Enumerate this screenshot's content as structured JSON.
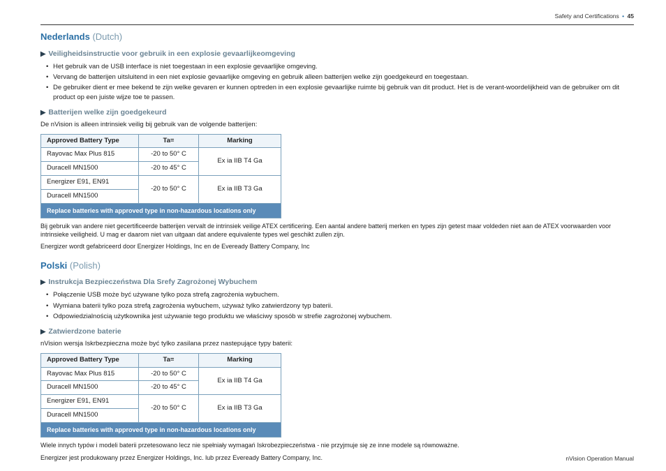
{
  "header": {
    "section": "Safety and Certifications",
    "page": "45"
  },
  "footer": {
    "manual": "nVision Operation Manual"
  },
  "triangle": "▶",
  "dutch": {
    "lang": "Nederlands",
    "paren": "(Dutch)",
    "subhead1": "Veiligheidsinstructie voor gebruik in een explosie gevaarlijkeomgeving",
    "bullets": [
      "Het gebruik van de USB interface is niet toegestaan in een explosie gevaarlijke omgeving.",
      "Vervang de batterijen uitsluitend in een niet explosie gevaarlijke omgeving en gebruik alleen batterijen welke zijn goedgekeurd en toegestaan.",
      "De gebruiker dient er mee bekend te zijn welke gevaren er kunnen optreden in een explosie gevaarlijke ruimte bij gebruik van dit product. Het is de verant-woordelijkheid van de gebruiker om dit product op een juiste wijze toe te passen."
    ],
    "subhead2": "Batterijen welke zijn goedgekeurd",
    "intro2": "De nVision is alleen intrinsiek veilig bij gebruik van de volgende batterijen:",
    "after1": "Bij gebruik van andere niet gecertificeerde batterijen vervalt de intrinsiek veilige ATEX certificering. Een aantal andere batterij merken en types zijn getest maar voldeden niet aan de ATEX voorwaarden voor intrinsieke veiligheid. U mag er daarom niet van uitgaan dat andere equivalente types wel geschikt zullen zijn.",
    "after2": "Energizer wordt gefabriceerd door Energizer Holdings, Inc en de Eveready Battery Company, Inc"
  },
  "polish": {
    "lang": "Polski",
    "paren": "(Polish)",
    "subhead1": "Instrukcja Bezpieczeństwa Dla Srefy Zagrożonej Wybuchem",
    "bullets": [
      "Połączenie USB może być używane tylko poza strefą zagrożenia wybuchem.",
      "Wymiana baterii tylko poza strefą zagrożenia wybuchem, używaż tylko zatwierdzony typ baterii.",
      "Odpowiedzialnością użytkownika jest używanie tego produktu we właściwy sposób w strefie zagrożonej wybuchem."
    ],
    "subhead2": "Zatwierdzone baterie",
    "intro2": "nVision wersja Iskrbezpieczna może być tylko zasilana przez nastepujące typy baterii:",
    "after1": "Wiele innych typów i modeli baterii przetesowano lecz nie spełniały wymagań Iskrobezpieczeństwa - nie przyjmuje się ze inne modele są równoważne.",
    "after2": "Energizer jest produkowany przez Energizer Holdings, Inc. lub przez Eveready Battery Company, Inc."
  },
  "table": {
    "headers": {
      "h1": "Approved Battery Type",
      "h2": "Ta=",
      "h3": "Marking"
    },
    "rows": [
      {
        "type": "Rayovac Max Plus 815",
        "ta": "-20 to 50° C"
      },
      {
        "type": "Duracell MN1500",
        "ta": "-20 to 45° C"
      },
      {
        "type": "Energizer E91, EN91",
        "ta": "-20 to 50° C"
      },
      {
        "type": "Duracell MN1500",
        "ta": ""
      }
    ],
    "marking1": "Ex ia IIB T4 Ga",
    "marking2": "Ex ia IIB T3 Ga",
    "notice": "Replace batteries with approved type in non-hazardous locations only"
  }
}
